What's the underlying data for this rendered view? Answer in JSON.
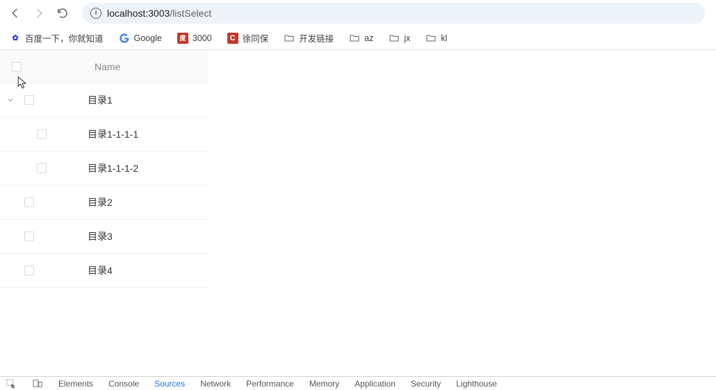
{
  "browser": {
    "address_host": "localhost:3003",
    "address_path": "/listSelect"
  },
  "bookmarks": [
    {
      "label": "百度一下，你就知道",
      "icon": "baidu"
    },
    {
      "label": "Google",
      "icon": "google"
    },
    {
      "label": "3000",
      "icon": "red3000"
    },
    {
      "label": "徐同保",
      "icon": "xtb"
    },
    {
      "label": "开发链接",
      "icon": "folder"
    },
    {
      "label": "az",
      "icon": "folder"
    },
    {
      "label": "jx",
      "icon": "folder"
    },
    {
      "label": "kl",
      "icon": "folder"
    }
  ],
  "table": {
    "header_name": "Name",
    "rows": [
      {
        "label": "目录1",
        "expandable": true,
        "expanded": true,
        "indent": 0
      },
      {
        "label": "目录1-1-1-1",
        "expandable": false,
        "indent": 1
      },
      {
        "label": "目录1-1-1-2",
        "expandable": false,
        "indent": 1
      },
      {
        "label": "目录2",
        "expandable": false,
        "indent": 0
      },
      {
        "label": "目录3",
        "expandable": false,
        "indent": 0
      },
      {
        "label": "目录4",
        "expandable": false,
        "indent": 0
      }
    ]
  },
  "devtools": {
    "tabs": [
      {
        "label": "Elements",
        "active": false
      },
      {
        "label": "Console",
        "active": false
      },
      {
        "label": "Sources",
        "active": true
      },
      {
        "label": "Network",
        "active": false
      },
      {
        "label": "Performance",
        "active": false
      },
      {
        "label": "Memory",
        "active": false
      },
      {
        "label": "Application",
        "active": false
      },
      {
        "label": "Security",
        "active": false
      },
      {
        "label": "Lighthouse",
        "active": false
      }
    ]
  },
  "icons": {
    "baidu_glyph": "✿",
    "xtb_glyph": "C",
    "red3000_glyph": "度"
  }
}
